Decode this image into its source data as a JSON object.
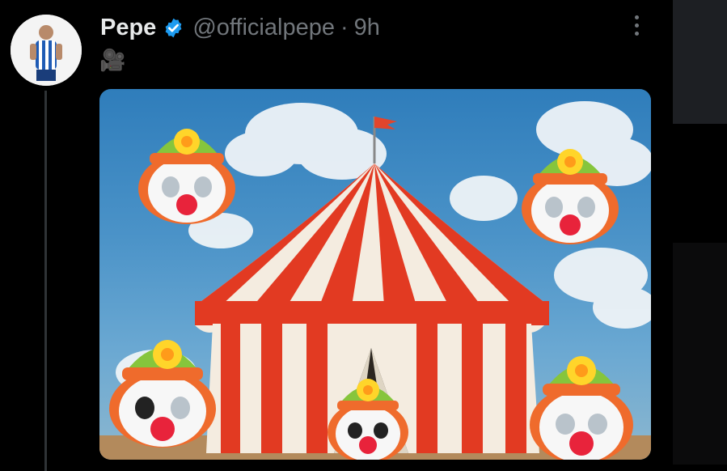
{
  "tweet": {
    "author_name": "Pepe",
    "handle": "@officialpepe",
    "separator": "·",
    "timestamp": "9h",
    "text": "🎥",
    "verified": true
  },
  "icons": {
    "verified": "verified-badge-icon",
    "more": "more-options-icon"
  },
  "media": {
    "description_tags": [
      "circus-tent",
      "clown-masks"
    ]
  },
  "colors": {
    "background": "#000000",
    "primary_text": "#e7e9ea",
    "secondary_text": "#71767b",
    "verified": "#1d9bf0"
  }
}
